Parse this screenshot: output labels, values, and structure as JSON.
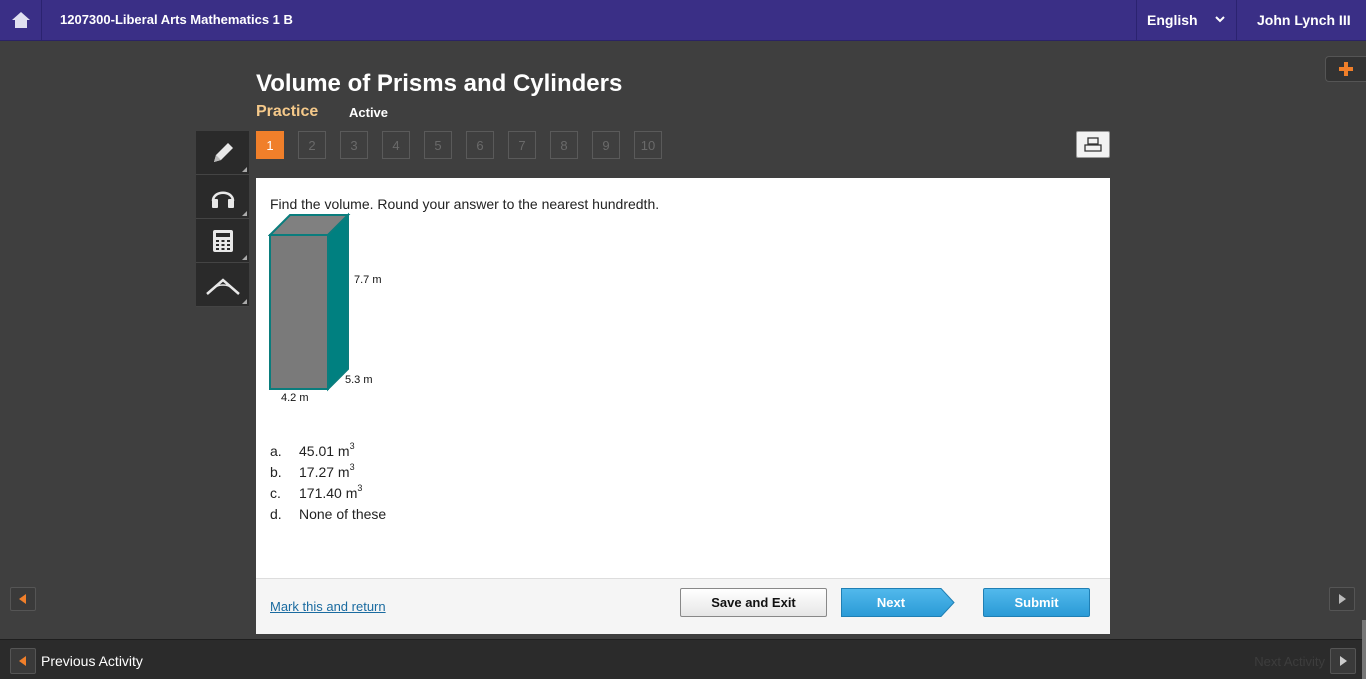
{
  "topbar": {
    "course": "1207300-Liberal Arts Mathematics 1 B",
    "language": "English",
    "user": "John Lynch III"
  },
  "header": {
    "title": "Volume of Prisms and Cylinders",
    "mode": "Practice",
    "status": "Active"
  },
  "pagination": {
    "pages": [
      "1",
      "2",
      "3",
      "4",
      "5",
      "6",
      "7",
      "8",
      "9",
      "10"
    ],
    "active": "1"
  },
  "tools": [
    {
      "icon": "pencil-icon"
    },
    {
      "icon": "headphones-icon"
    },
    {
      "icon": "calculator-icon"
    },
    {
      "icon": "angle-tool-icon"
    }
  ],
  "question": {
    "prompt": "Find the volume. Round your answer to the nearest hundredth.",
    "figure": {
      "height_label": "7.7 m",
      "depth_label": "5.3 m",
      "width_label": "4.2 m",
      "front_color": "#7a7a7a",
      "side_color": "#008080"
    },
    "choices": [
      {
        "letter": "a.",
        "text": "45.01 m",
        "sup": "3"
      },
      {
        "letter": "b.",
        "text": "17.27 m",
        "sup": "3"
      },
      {
        "letter": "c.",
        "text": "171.40 m",
        "sup": "3"
      },
      {
        "letter": "d.",
        "text": "None of these",
        "sup": ""
      }
    ]
  },
  "footer": {
    "mark_link": "Mark this and return",
    "save_label": "Save and Exit",
    "next_label": "Next",
    "submit_label": "Submit"
  },
  "bottombar": {
    "previous": "Previous Activity",
    "next": "Next Activity"
  },
  "colors": {
    "topbar": "#3a2f86",
    "accent_orange": "#f07f2a",
    "button_blue": "#2a9ad6"
  }
}
